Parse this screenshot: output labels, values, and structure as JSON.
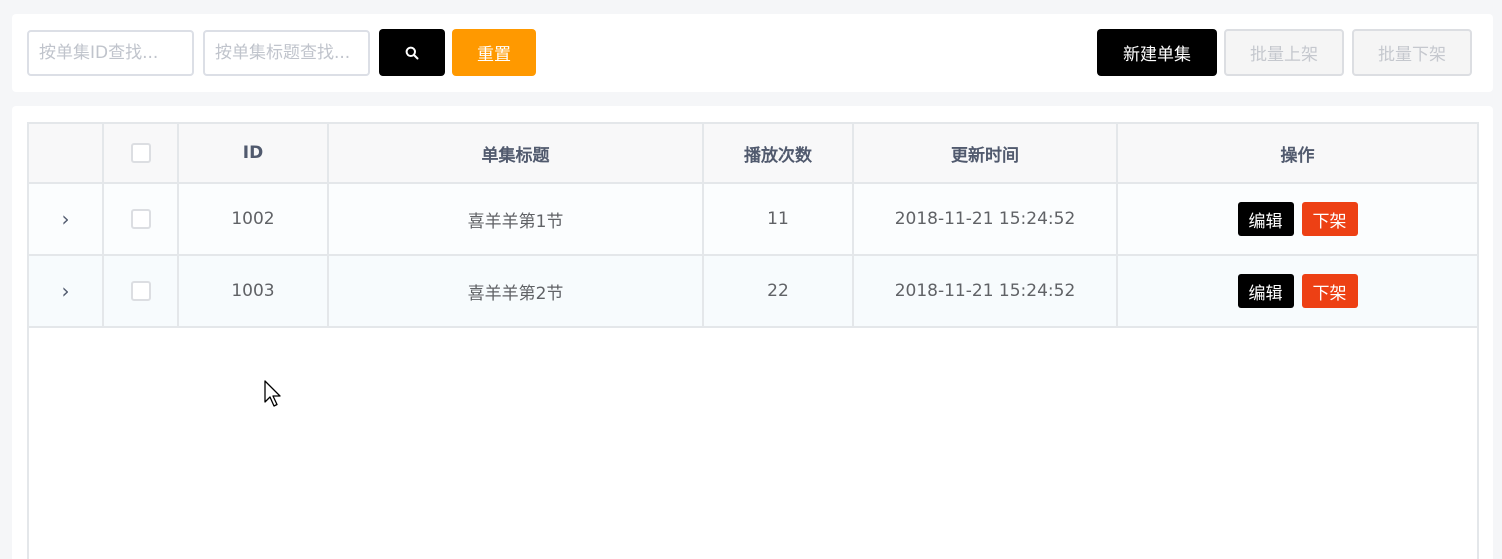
{
  "toolbar": {
    "id_placeholder": "按单集ID查找...",
    "title_placeholder": "按单集标题查找...",
    "reset_label": "重置",
    "new_label": "新建单集",
    "batch_on_label": "批量上架",
    "batch_off_label": "批量下架"
  },
  "table": {
    "columns": [
      "",
      "",
      "ID",
      "单集标题",
      "播放次数",
      "更新时间",
      "操作"
    ],
    "rows": [
      {
        "id": "1002",
        "title": "喜羊羊第1节",
        "plays": "11",
        "updated": "2018-11-21 15:24:52",
        "edit_label": "编辑",
        "off_label": "下架"
      },
      {
        "id": "1003",
        "title": "喜羊羊第2节",
        "plays": "22",
        "updated": "2018-11-21 15:24:52",
        "edit_label": "编辑",
        "off_label": "下架"
      }
    ]
  },
  "colors": {
    "primary": "#000000",
    "reset": "#ff9900",
    "danger": "#ed4014",
    "background": "#f5f6f8"
  },
  "icons": [
    "search-icon",
    "chevron-right-icon",
    "mouse-cursor-icon"
  ]
}
